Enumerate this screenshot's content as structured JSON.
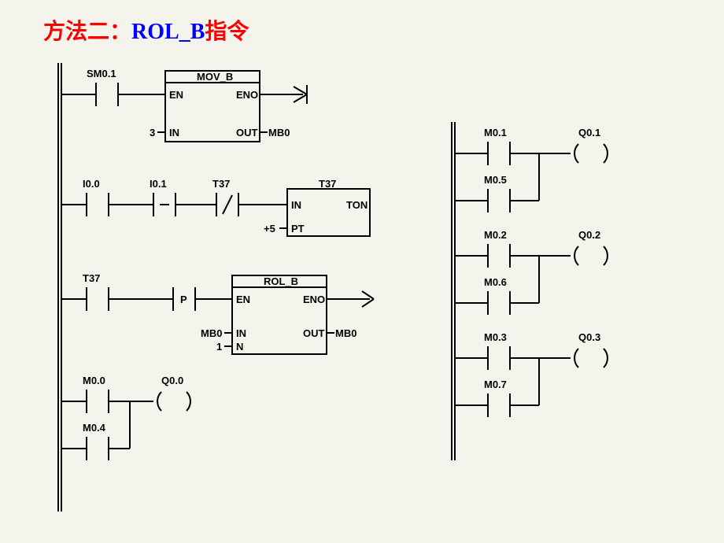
{
  "title_red": "方法二：",
  "title_blue": "ROL_B",
  "title_red2": "指令",
  "left_diagram": {
    "rung1": {
      "contact1": "SM0.1",
      "box": {
        "title": "MOV_B",
        "en": "EN",
        "eno": "ENO",
        "in": "IN",
        "out": "OUT",
        "in_val": "3",
        "out_val": "MB0"
      }
    },
    "rung2": {
      "contact1": "I0.0",
      "contact2": "I0.1",
      "contact3": "T37",
      "box": {
        "ref": "T37",
        "in": "IN",
        "pt": "PT",
        "ton": "TON",
        "pt_val": "+5"
      }
    },
    "rung3": {
      "contact1": "T37",
      "contact2": "P",
      "box": {
        "title": "ROL_B",
        "en": "EN",
        "eno": "ENO",
        "in": "IN",
        "out": "OUT",
        "n": "N",
        "in_val": "MB0",
        "out_val": "MB0",
        "n_val": "1"
      }
    },
    "rung4": {
      "contact1": "M0.0",
      "contact2": "M0.4",
      "coil": "Q0.0"
    }
  },
  "right_diagram": {
    "rung1": {
      "c1": "M0.1",
      "c2": "M0.5",
      "coil": "Q0.1"
    },
    "rung2": {
      "c1": "M0.2",
      "c2": "M0.6",
      "coil": "Q0.2"
    },
    "rung3": {
      "c1": "M0.3",
      "c2": "M0.7",
      "coil": "Q0.3"
    }
  }
}
